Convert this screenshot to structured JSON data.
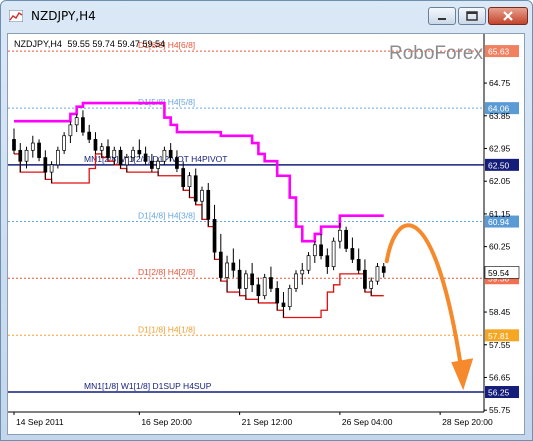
{
  "window": {
    "title": "NZDJPY,H4",
    "buttons": {
      "minimize": "minimize-icon",
      "maximize": "maximize-icon",
      "close": "close-icon"
    }
  },
  "chart_header": {
    "symbol_tf": "NZDJPY,H4",
    "ohlc": "59.55 59.74 59.47 59.54"
  },
  "watermark": "RoboForex",
  "chart_data": {
    "type": "candlestick",
    "title": "NZDJPY,H4",
    "ylim": [
      55.7,
      66.1
    ],
    "xlim": [
      0,
      75
    ],
    "price_ticks": [
      "65.63",
      "64.75",
      "64.06",
      "63.85",
      "62.95",
      "62.50",
      "62.05",
      "61.15",
      "60.94",
      "60.25",
      "59.54",
      "59.38",
      "58.45",
      "57.81",
      "57.55",
      "56.65",
      "56.25",
      "55.75"
    ],
    "time_labels": [
      {
        "label": "14 Sep 2011",
        "x": 0
      },
      {
        "label": "16 Sep 20:00",
        "x": 20
      },
      {
        "label": "21 Sep 12:00",
        "x": 36
      },
      {
        "label": "26 Sep 04:00",
        "x": 52
      },
      {
        "label": "28 Sep 20:00",
        "x": 68
      }
    ],
    "levels": [
      {
        "name": "D1[6/8] H4[6/8]",
        "price": 65.63,
        "color": "#e8553a",
        "style": "dotted",
        "tag_color": "#f08060"
      },
      {
        "name": "D1[5/8] H4[5/8]",
        "price": 64.06,
        "color": "#6aa6e0",
        "style": "dotted",
        "tag_color": "#5b9bd5"
      },
      {
        "name": "MN1[2/8] W1[2/8] D1PIVOT H4PIVOT",
        "price": 62.5,
        "color": "#141e7a",
        "style": "solid",
        "tag_color": "#141e7a"
      },
      {
        "name": "D1[4/8] H4[3/8]",
        "price": 60.94,
        "color": "#6aa6e0",
        "style": "dotted",
        "tag_color": "#5b9bd5"
      },
      {
        "name": "D1[2/8] H4[2/8]",
        "price": 59.38,
        "color": "#e8553a",
        "style": "dotted",
        "tag_color": "#f07050"
      },
      {
        "name": "D1[1/8] H4[1/8]",
        "price": 57.81,
        "color": "#f0a030",
        "style": "dotted",
        "tag_color": "#f5a623"
      },
      {
        "name": "MN1[1/8] W1[1/8] D1SUP H4SUP",
        "price": 56.25,
        "color": "#141e7a",
        "style": "solid",
        "tag_color": "#141e7a"
      }
    ],
    "current_price": {
      "label": "59.54",
      "price": 59.54
    },
    "candles": [
      [
        63.2,
        63.5,
        62.8,
        62.9
      ],
      [
        62.9,
        63.1,
        62.3,
        62.6
      ],
      [
        62.6,
        63.0,
        62.4,
        62.9
      ],
      [
        62.9,
        63.3,
        62.7,
        63.1
      ],
      [
        63.1,
        63.2,
        62.6,
        62.7
      ],
      [
        62.7,
        62.9,
        62.1,
        62.3
      ],
      [
        62.3,
        62.6,
        62.0,
        62.5
      ],
      [
        62.5,
        63.0,
        62.4,
        62.9
      ],
      [
        62.9,
        63.4,
        62.8,
        63.3
      ],
      [
        63.3,
        63.7,
        63.1,
        63.6
      ],
      [
        63.6,
        63.9,
        63.4,
        63.8
      ],
      [
        63.8,
        64.0,
        63.3,
        63.4
      ],
      [
        63.4,
        63.6,
        63.1,
        63.2
      ],
      [
        63.2,
        63.4,
        62.8,
        62.9
      ],
      [
        62.9,
        63.1,
        62.7,
        63.0
      ],
      [
        63.0,
        63.2,
        62.6,
        62.7
      ],
      [
        62.7,
        63.0,
        62.5,
        62.9
      ],
      [
        62.9,
        63.0,
        62.4,
        62.5
      ],
      [
        62.5,
        62.8,
        62.3,
        62.7
      ],
      [
        62.7,
        63.0,
        62.6,
        62.9
      ],
      [
        62.9,
        63.2,
        62.7,
        62.8
      ],
      [
        62.8,
        63.0,
        62.5,
        62.6
      ],
      [
        62.6,
        62.8,
        62.3,
        62.4
      ],
      [
        62.4,
        62.7,
        62.2,
        62.6
      ],
      [
        62.6,
        63.0,
        62.5,
        62.9
      ],
      [
        62.9,
        63.1,
        62.6,
        62.7
      ],
      [
        62.7,
        62.9,
        62.3,
        62.4
      ],
      [
        62.4,
        62.6,
        61.8,
        61.9
      ],
      [
        61.9,
        62.3,
        61.6,
        62.2
      ],
      [
        62.2,
        62.4,
        61.4,
        61.5
      ],
      [
        61.5,
        61.9,
        61.0,
        61.8
      ],
      [
        61.8,
        62.0,
        60.8,
        61.0
      ],
      [
        61.0,
        61.4,
        59.9,
        60.1
      ],
      [
        60.1,
        60.6,
        59.3,
        59.4
      ],
      [
        59.4,
        60.0,
        59.0,
        59.8
      ],
      [
        59.8,
        60.2,
        59.4,
        59.6
      ],
      [
        59.6,
        59.9,
        58.9,
        59.1
      ],
      [
        59.1,
        59.6,
        58.8,
        59.5
      ],
      [
        59.5,
        59.8,
        59.0,
        59.2
      ],
      [
        59.2,
        59.4,
        58.7,
        58.9
      ],
      [
        58.9,
        59.5,
        58.8,
        59.4
      ],
      [
        59.4,
        59.7,
        59.0,
        59.1
      ],
      [
        59.1,
        59.3,
        58.5,
        58.7
      ],
      [
        58.7,
        59.0,
        58.3,
        58.6
      ],
      [
        58.6,
        59.2,
        58.5,
        59.1
      ],
      [
        59.1,
        59.6,
        59.0,
        59.5
      ],
      [
        59.5,
        59.8,
        59.2,
        59.6
      ],
      [
        59.6,
        60.1,
        59.5,
        60.0
      ],
      [
        60.0,
        60.4,
        59.8,
        60.3
      ],
      [
        60.3,
        60.6,
        59.9,
        60.0
      ],
      [
        60.0,
        60.2,
        59.5,
        59.7
      ],
      [
        59.7,
        60.5,
        59.6,
        60.4
      ],
      [
        60.4,
        60.9,
        60.2,
        60.7
      ],
      [
        60.7,
        60.8,
        60.1,
        60.2
      ],
      [
        60.2,
        60.5,
        59.8,
        59.9
      ],
      [
        59.9,
        60.2,
        59.5,
        59.6
      ],
      [
        59.6,
        59.9,
        59.0,
        59.1
      ],
      [
        59.1,
        59.4,
        58.9,
        59.3
      ],
      [
        59.3,
        59.8,
        59.2,
        59.7
      ],
      [
        59.7,
        59.8,
        59.4,
        59.54
      ]
    ]
  }
}
